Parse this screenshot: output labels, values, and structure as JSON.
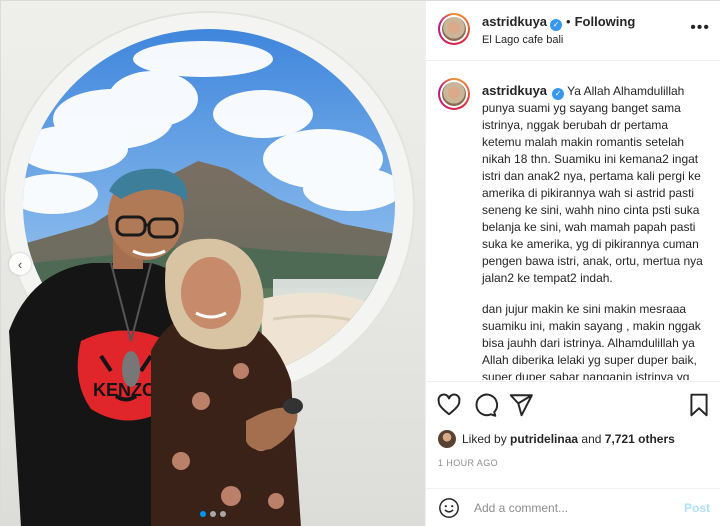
{
  "post": {
    "username": "astridkuya",
    "verified_mark": "✓",
    "separator": "•",
    "follow_status": "Following",
    "location": "El Lago cafe bali",
    "more_label": "•••"
  },
  "caption": {
    "username": "astridkuya",
    "paragraph_1": "Ya Allah Alhamdulillah punya suami yg sayang banget sama istrinya, nggak berubah dr pertama ketemu malah makin romantis setelah nikah 18 thn. Suamiku ini kemana2 ingat istri dan anak2 nya, pertama kali pergi ke amerika di pikirannya wah si astrid pasti seneng ke sini, wahh nino cinta psti suka belanja ke sini, wah mamah papah pasti suka ke amerika, yg di pikirannya cuman pengen bawa istri, anak, ortu, mertua nya jalan2 ke tempat2 indah.",
    "paragraph_2": "dan jujur makin ke sini makin mesraaa suamiku ini, makin sayang , makin nggak bisa jauhh dari istrinya. Alhamdulillah ya Allah diberika lelaki yg super duper baik, super duper sabar nanganin istrinya yg kayak preman wwkkwkwkw 🥹🥹"
  },
  "likes": {
    "prefix": "Liked by",
    "user": "putridelinaa",
    "connector": "and",
    "count": "7,721 others"
  },
  "timestamp": "1 HOUR AGO",
  "comment": {
    "placeholder": "Add a comment...",
    "post_label": "Post"
  },
  "carousel": {
    "prev_arrow": "‹",
    "current_slide": 1,
    "total_slides": 3
  },
  "icons": [
    "heart-icon",
    "comment-icon",
    "share-icon",
    "bookmark-icon",
    "emoji-icon",
    "chevron-left-icon",
    "more-icon"
  ],
  "colors": {
    "accent": "#0095f6",
    "verified": "#3897f0",
    "post_disabled": "#b2dffc",
    "muted": "#8e8e8e"
  }
}
